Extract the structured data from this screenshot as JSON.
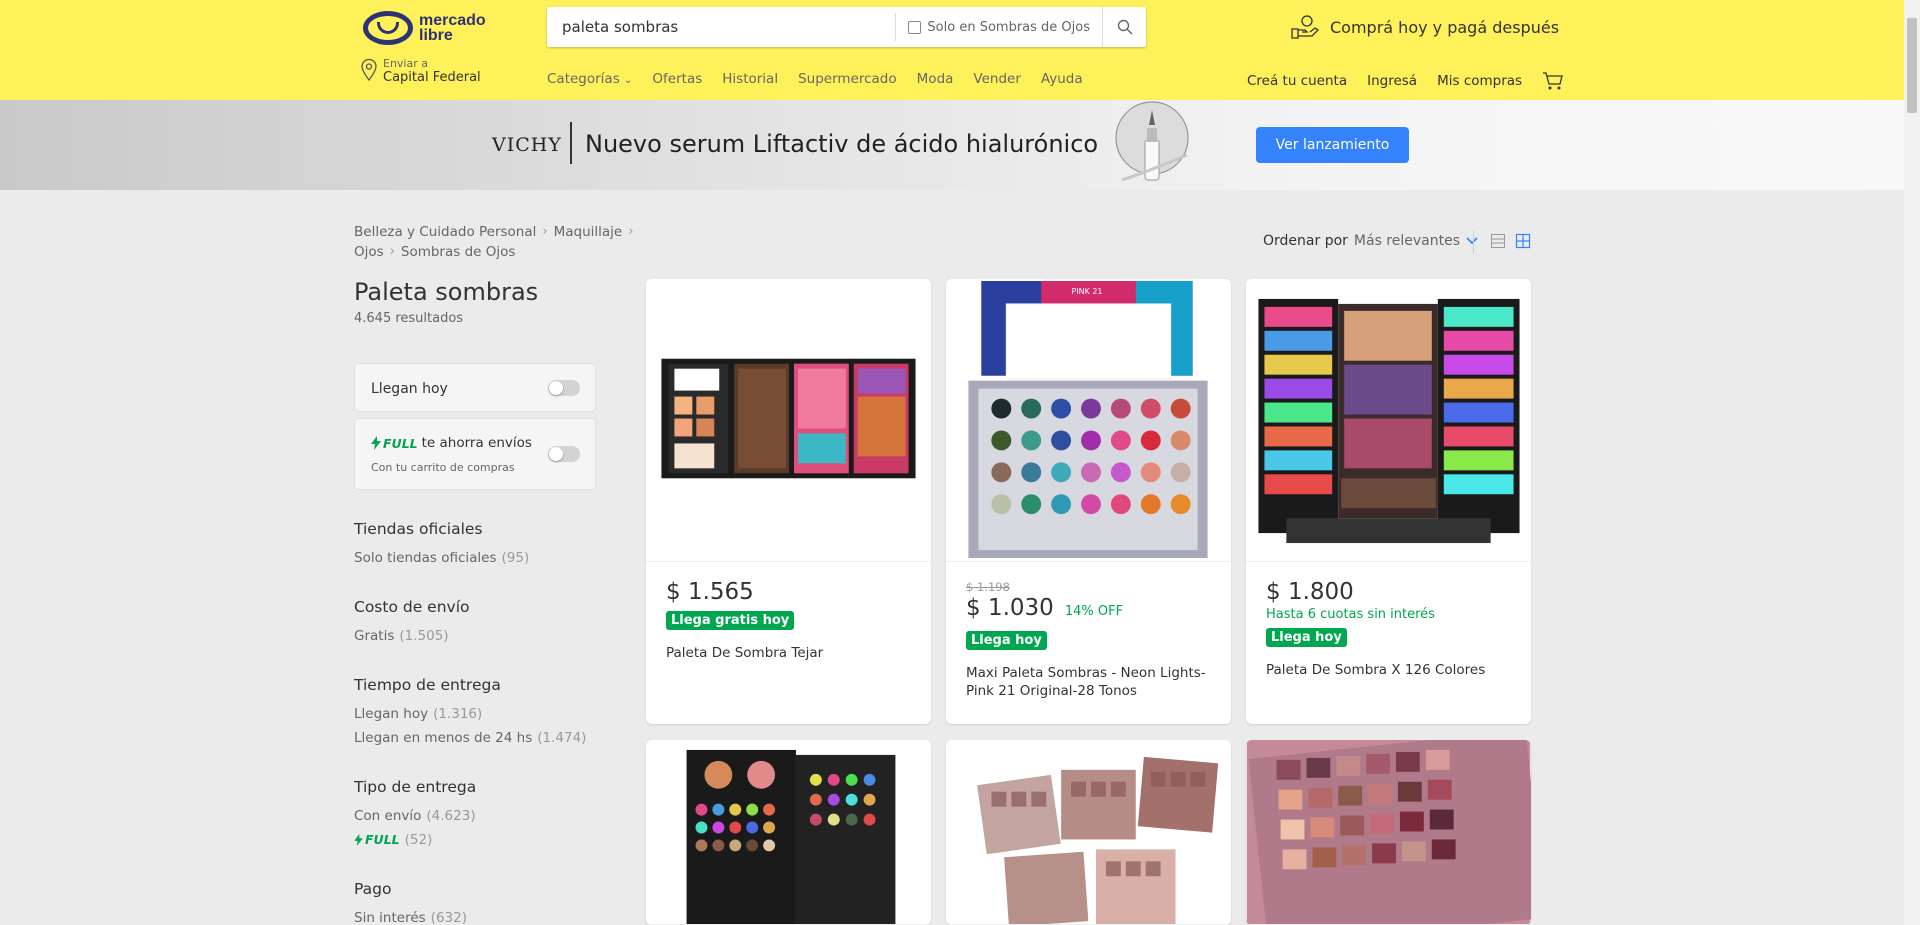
{
  "header": {
    "logo_line1": "mercado",
    "logo_line2": "libre",
    "search_value": "paleta sombras",
    "search_filter_label": "Solo en Sombras de Ojos",
    "promo_text": "Comprá hoy y pagá después",
    "location_small": "Enviar a",
    "location_big": "Capital Federal",
    "nav": [
      "Categorías",
      "Ofertas",
      "Historial",
      "Supermercado",
      "Moda",
      "Vender",
      "Ayuda"
    ],
    "user_nav": [
      "Creá tu cuenta",
      "Ingresá",
      "Mis compras"
    ]
  },
  "banner": {
    "brand": "VICHY",
    "text": "Nuevo serum Liftactiv de ácido hialurónico",
    "button": "Ver lanzamiento"
  },
  "breadcrumb": [
    "Belleza y Cuidado Personal",
    "Maquillaje",
    "Ojos",
    "Sombras de Ojos"
  ],
  "results": {
    "title": "Paleta sombras",
    "count": "4.645 resultados"
  },
  "toggles": {
    "today": "Llegan hoy",
    "full_badge": "FULL",
    "full_text": "te ahorra envíos",
    "full_sub": "Con tu carrito de compras"
  },
  "filters": [
    {
      "title": "Tiendas oficiales",
      "items": [
        {
          "label": "Solo tiendas oficiales",
          "count": "(95)"
        }
      ]
    },
    {
      "title": "Costo de envío",
      "items": [
        {
          "label": "Gratis",
          "count": "(1.505)"
        }
      ]
    },
    {
      "title": "Tiempo de entrega",
      "items": [
        {
          "label": "Llegan hoy",
          "count": "(1.316)"
        },
        {
          "label": "Llegan en menos de 24 hs",
          "count": "(1.474)"
        }
      ]
    },
    {
      "title": "Tipo de entrega",
      "items": [
        {
          "label": "Con envío",
          "count": "(4.623)"
        },
        {
          "label": "FULL",
          "count": "(52)"
        }
      ]
    },
    {
      "title": "Pago",
      "items": [
        {
          "label": "Sin interés",
          "count": "(632)"
        }
      ]
    }
  ],
  "sort": {
    "label": "Ordenar por",
    "value": "Más relevantes"
  },
  "products": [
    {
      "price": "$ 1.565",
      "badge": "Llega gratis hoy",
      "name": "Paleta De Sombra Tejar"
    },
    {
      "old_price": "$ 1.198",
      "price": "$ 1.030",
      "discount": "14% OFF",
      "badge": "Llega hoy",
      "name": "Maxi Paleta Sombras - Neon Lights- Pink 21 Original-28 Tonos",
      "img_text": "PINK 21"
    },
    {
      "price": "$ 1.800",
      "installments": "Hasta 6 cuotas sin interés",
      "badge": "Llega hoy",
      "name": "Paleta De Sombra X 126 Colores"
    }
  ],
  "colors": {
    "header_bg": "#fff159",
    "accent_blue": "#3483fa",
    "green": "#00a650"
  }
}
